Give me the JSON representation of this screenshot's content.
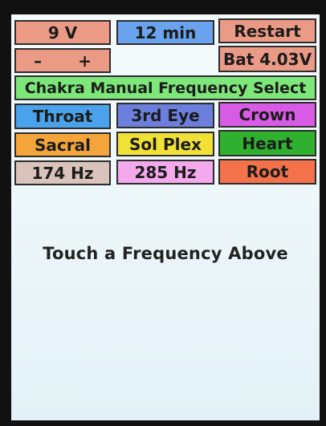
{
  "top_row": {
    "voltage": "9 V",
    "timer": "12 min",
    "restart": "Restart"
  },
  "second_row": {
    "minus": "–",
    "plus": "+",
    "battery": "Bat 4.03V"
  },
  "section_title": "Chakra Manual Frequency Select",
  "chakras": {
    "throat": "Throat",
    "third_eye": "3rd Eye",
    "crown": "Crown",
    "sacral": "Sacral",
    "sol_plex": "Sol Plex",
    "heart": "Heart",
    "hz_174": "174 Hz",
    "hz_285": "285 Hz",
    "root": "Root"
  },
  "message": "Touch a Frequency Above"
}
